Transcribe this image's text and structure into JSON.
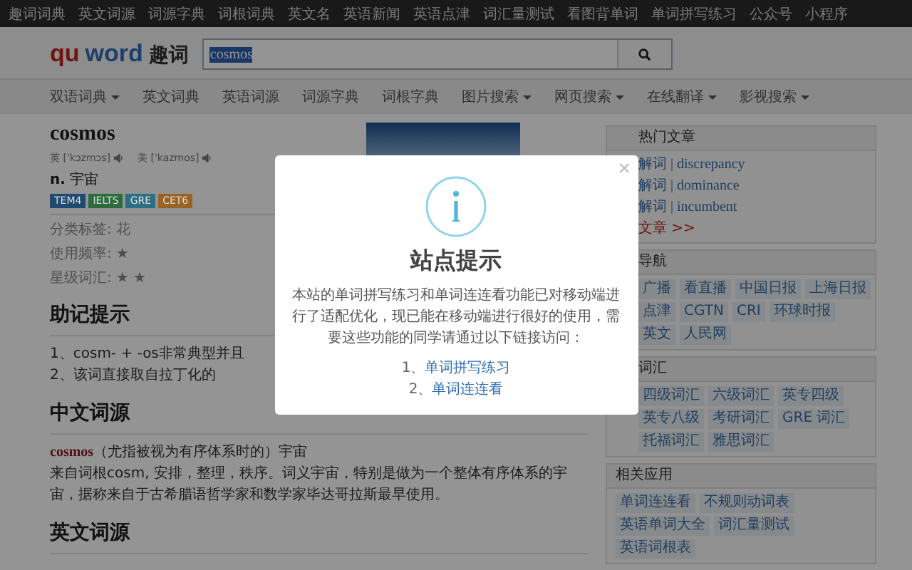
{
  "top_nav": [
    "趣词词典",
    "英文词源",
    "词源字典",
    "词根词典",
    "英文名",
    "英语新闻",
    "英语点津",
    "词汇量测试",
    "看图背单词",
    "单词拼写练习",
    "公众号",
    "小程序"
  ],
  "logo": {
    "red": "qu",
    "blue": "word",
    "cn": "趣词"
  },
  "search": {
    "value": "cosmos",
    "value_selected": true
  },
  "menu": [
    {
      "label": "双语词典",
      "dropdown": true
    },
    {
      "label": "英文词典",
      "dropdown": false
    },
    {
      "label": "英语词源",
      "dropdown": false
    },
    {
      "label": "词源字典",
      "dropdown": false
    },
    {
      "label": "词根字典",
      "dropdown": false
    },
    {
      "label": "图片搜索",
      "dropdown": true
    },
    {
      "label": "网页搜索",
      "dropdown": true
    },
    {
      "label": "在线翻译",
      "dropdown": true
    },
    {
      "label": "影视搜索",
      "dropdown": true
    }
  ],
  "word": {
    "headword": "cosmos",
    "pronunciations": [
      {
        "region": "英",
        "ipa": "['kɔzmɔs]"
      },
      {
        "region": "美",
        "ipa": "['kazmos]"
      }
    ],
    "definition": {
      "pos": "n.",
      "meaning": "宇宙"
    },
    "tags": [
      {
        "label": "TEM4",
        "color": "#1f4a70"
      },
      {
        "label": "IELTS",
        "color": "#2c6b3d"
      },
      {
        "label": "GRE",
        "color": "#2e6e85"
      },
      {
        "label": "CET6",
        "color": "#9a6322"
      }
    ],
    "meta": [
      {
        "label": "分类标签:",
        "value": "花"
      },
      {
        "label": "使用频率:",
        "value": "★"
      },
      {
        "label": "星级词汇:",
        "value": "★ ★"
      }
    ]
  },
  "mnemonic": {
    "heading": "助记提示",
    "items": [
      "1、cosm- + -os非常典型并且",
      "2、该词直接取自拉丁化的"
    ]
  },
  "chinese_etymology": {
    "heading": "中文词源",
    "term": "cosmos",
    "gloss": "（尤指被视为有序体系时的）宇宙",
    "body": "来自词根cosm, 安排，整理，秩序。词义宇宙，特别是做为一个整体有序体系的宇宙，据称来自于古希腊语哲学家和数学家毕达哥拉斯最早使用。"
  },
  "english_etymology": {
    "heading": "英文词源"
  },
  "sidebar": [
    {
      "heading": "热门文章",
      "kind": "links",
      "items": [
        "解词 | discrepancy",
        "解词 | dominance",
        "解词 | incumbent"
      ],
      "more": "文章 >>"
    },
    {
      "heading": "导航",
      "kind": "tags",
      "items": [
        "广播",
        "看直播",
        "中国日报",
        "上海日报",
        "点津",
        "CGTN",
        "CRI",
        "环球时报",
        "英文",
        "人民网"
      ]
    },
    {
      "heading": "词汇",
      "kind": "tags",
      "items": [
        "四级词汇",
        "六级词汇",
        "英专四级",
        "英专八级",
        "考研词汇",
        "GRE 词汇",
        "托福词汇",
        "雅思词汇"
      ]
    },
    {
      "heading": "相关应用",
      "kind": "tags",
      "items": [
        "单词连连看",
        "不规则动词表",
        "英语单词大全",
        "词汇量测试",
        "英语词根表"
      ]
    }
  ],
  "modal": {
    "close": "×",
    "title": "站点提示",
    "body": "本站的单词拼写练习和单词连连看功能已对移动端进行了适配优化，现已能在移动端进行很好的使用，需要这些功能的同学请通过以下链接访问：",
    "links": [
      {
        "number": "1、",
        "label": "单词拼写练习"
      },
      {
        "number": "2、",
        "label": "单词连连看"
      }
    ]
  }
}
